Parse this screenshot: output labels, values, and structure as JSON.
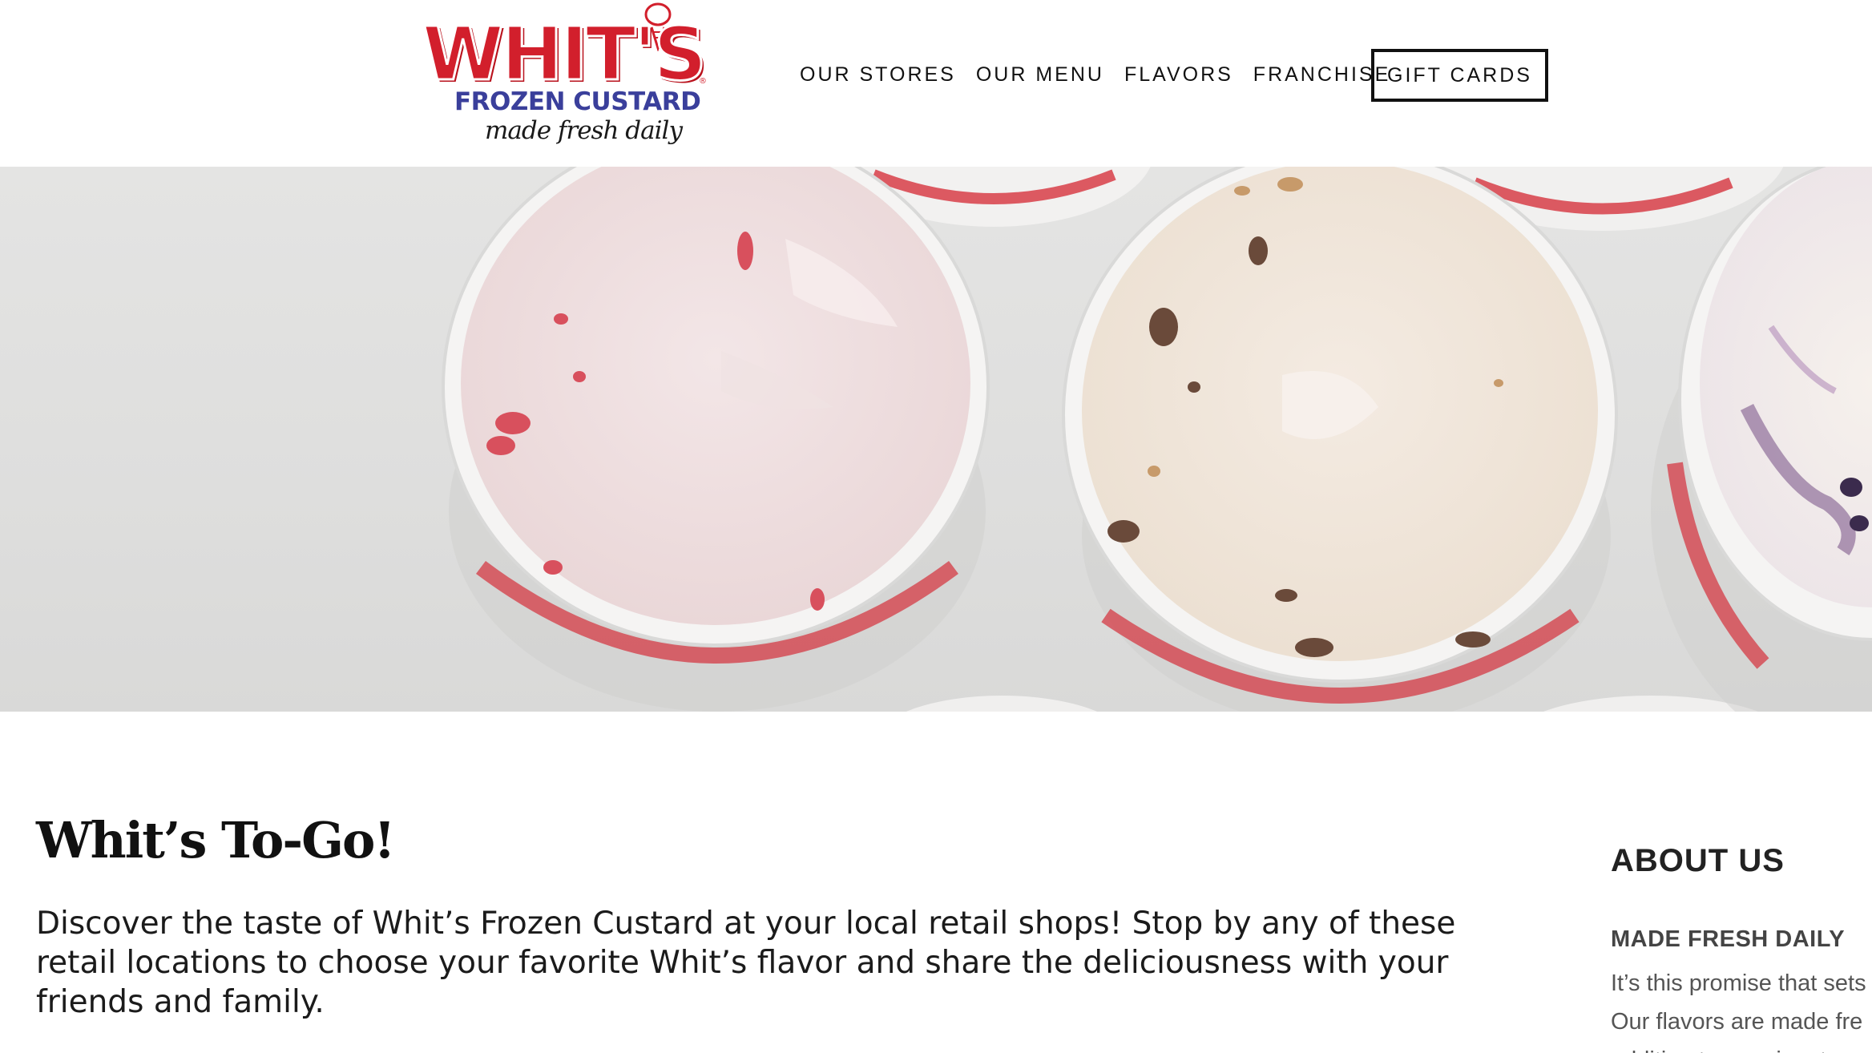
{
  "brand": {
    "logo_word": "WHIT'S",
    "logo_sub": "FROZEN CUSTARD",
    "logo_tagline": "made fresh daily",
    "logo_reg": "®",
    "colors": {
      "red": "#d21f2c",
      "blue": "#3a3f9b",
      "text": "#111111"
    }
  },
  "nav": {
    "items": [
      {
        "label": "OUR STORES"
      },
      {
        "label": "OUR MENU"
      },
      {
        "label": "FLAVORS"
      },
      {
        "label": "FRANCHISE"
      }
    ],
    "gift_cards_label": "GIFT CARDS"
  },
  "hero": {
    "image": "custard pints top view"
  },
  "main": {
    "title": "Whit’s To-Go!",
    "intro": "Discover the taste of Whit’s Frozen Custard at your local retail shops! Stop by any of these retail locations to choose your favorite Whit’s flavor and share the deliciousness with your friends and family."
  },
  "sidebar": {
    "title": "ABOUT US",
    "subtitle": "MADE FRESH DAILY",
    "lines": [
      "It’s this promise that sets",
      "Our flavors are made fre",
      "addition to our signature"
    ]
  }
}
